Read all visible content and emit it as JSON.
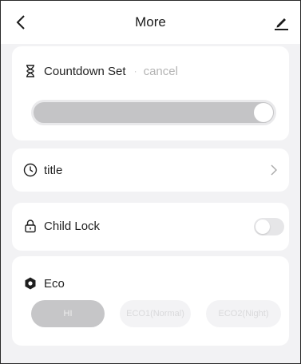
{
  "header": {
    "title": "More",
    "back_icon": "chevron-left-icon",
    "edit_icon": "pencil-icon"
  },
  "countdown": {
    "icon": "hourglass-icon",
    "label": "Countdown Set",
    "separator": "·",
    "cancel_label": "cancel",
    "slider_value_fraction": 1.0
  },
  "schedule": {
    "icon": "clock-icon",
    "label": "title",
    "chevron_icon": "chevron-right-icon"
  },
  "child_lock": {
    "icon": "lock-icon",
    "label": "Child Lock",
    "enabled": false
  },
  "eco": {
    "icon": "eco-hexagon-icon",
    "label": "Eco",
    "modes": [
      {
        "label": "HI",
        "selected": true
      },
      {
        "label": "ECO1(Normal)",
        "selected": false
      },
      {
        "label": "ECO2(Night)",
        "selected": false
      }
    ]
  },
  "colors": {
    "background": "#f2f2f4",
    "card": "#ffffff",
    "slider_fill": "#c4c4c6",
    "selected_mode": "#c6c6c8",
    "disabled_text": "#b4b4b4"
  }
}
